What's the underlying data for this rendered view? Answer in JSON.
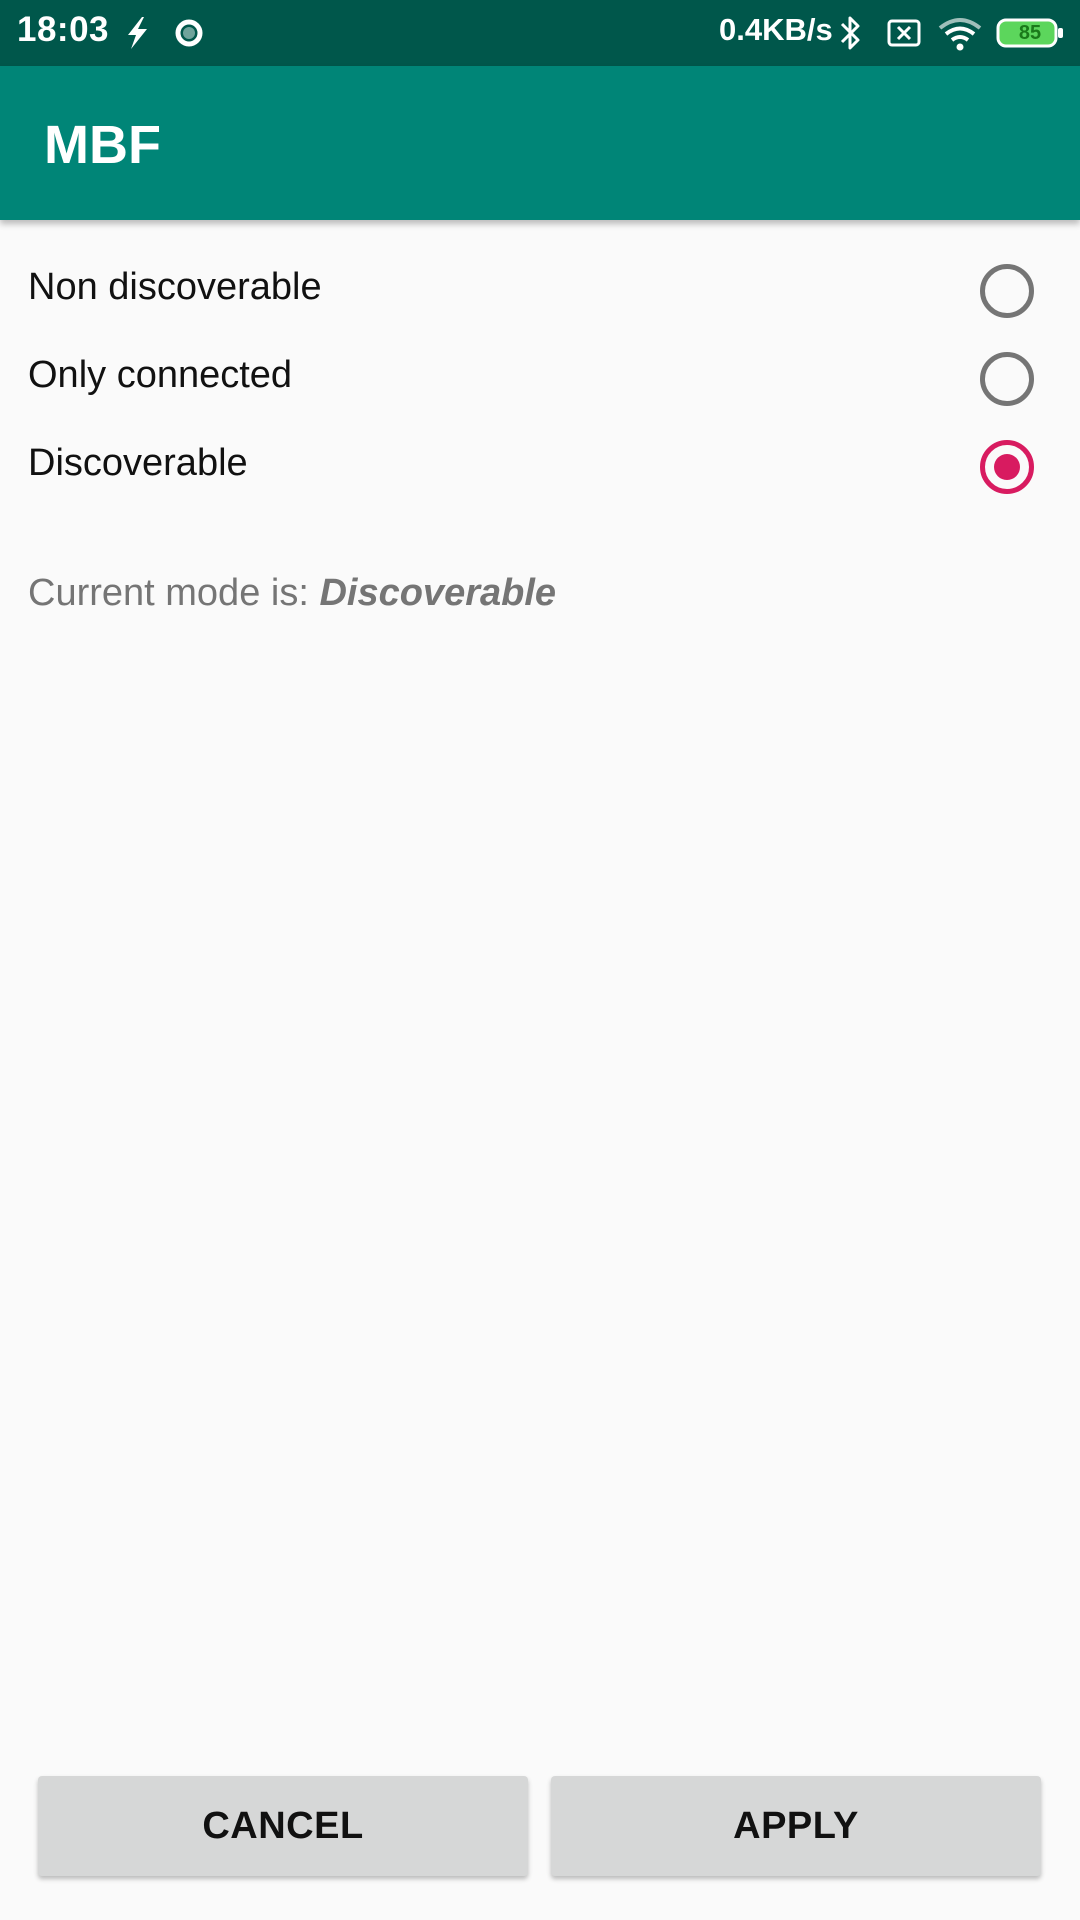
{
  "status_bar": {
    "time": "18:03",
    "network_speed": "0.4KB/s",
    "battery_level": "85",
    "icons": [
      "flash-icon",
      "sync-ring-icon",
      "bluetooth-icon",
      "no-sim-icon",
      "wifi-icon",
      "battery-icon"
    ]
  },
  "app_bar": {
    "title": "MBF"
  },
  "options": [
    {
      "label": "Non discoverable",
      "checked": false
    },
    {
      "label": "Only connected",
      "checked": false
    },
    {
      "label": "Discoverable",
      "checked": true
    }
  ],
  "current_mode": {
    "prefix": "Current mode is: ",
    "value": "Discoverable"
  },
  "buttons": {
    "cancel_label": "CANCEL",
    "apply_label": "APPLY"
  },
  "colors": {
    "status_bar": "#00574b",
    "app_bar": "#008577",
    "accent": "#d81b60",
    "radio_unchecked": "#757575",
    "button_bg": "#d6d7d7"
  }
}
